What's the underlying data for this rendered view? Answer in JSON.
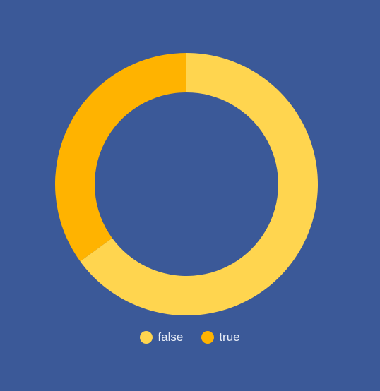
{
  "chart_data": {
    "type": "pie",
    "categories": [
      "false",
      "true"
    ],
    "values": [
      65,
      35
    ],
    "series": [
      {
        "values": [
          65,
          35
        ]
      }
    ],
    "title": "",
    "legend": "bottom-center",
    "grid": false
  },
  "legend": {
    "items": [
      {
        "label": "false",
        "color": "#ffd54f"
      },
      {
        "label": "true",
        "color": "#ffb300"
      }
    ]
  },
  "theme": {
    "background": "#3b5998",
    "legend_text": "#e9eef8"
  }
}
